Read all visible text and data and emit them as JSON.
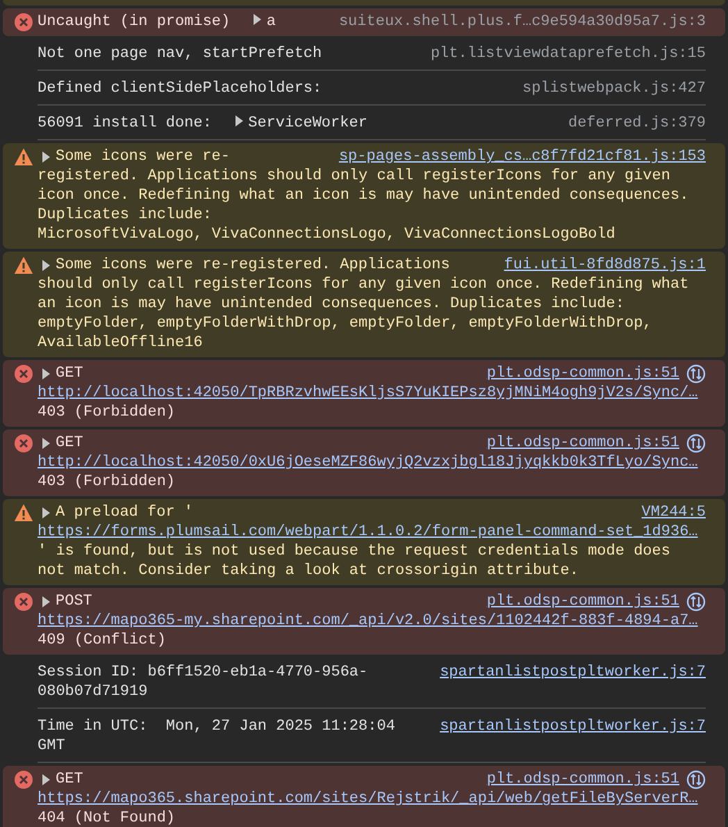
{
  "console": {
    "entries": [
      {
        "kind": "error",
        "message": "Uncaught (in promise)",
        "object": {
          "label": "a",
          "expanded": false
        },
        "source": "suiteux.shell.plus.f…c9e594a30d95a7.js:3",
        "source_link": false
      },
      {
        "kind": "info",
        "message": "Not one page nav, startPrefetch",
        "source": "plt.listviewdataprefetch.js:15",
        "source_link": false
      },
      {
        "kind": "info",
        "message": "Defined clientSidePlaceholders:",
        "source": "splistwebpack.js:427",
        "source_link": false
      },
      {
        "kind": "info",
        "message": "56091 install done:",
        "object": {
          "label": "ServiceWorker",
          "expanded": false
        },
        "source": "deferred.js:379",
        "source_link": false
      },
      {
        "kind": "warning",
        "expanded": false,
        "message": "Some icons were re-",
        "continuation": "registered. Applications should only call registerIcons for any given icon once. Redefining what an icon is may have unintended consequences. Duplicates include:\nMicrosoftVivaLogo, VivaConnectionsLogo, VivaConnectionsLogoBold",
        "source": "sp-pages-assembly_cs…c8f7fd21cf81.js:153",
        "source_link": true
      },
      {
        "kind": "warning",
        "expanded": false,
        "message": "Some icons were re-registered. Applications",
        "continuation": "should only call registerIcons for any given icon once. Redefining what an icon is may have unintended consequences. Duplicates include:\nemptyFolder, emptyFolderWithDrop, emptyFolder, emptyFolderWithDrop, AvailableOffline16",
        "source": "fui.util-8fd8d875.js:1",
        "source_link": true
      },
      {
        "kind": "error",
        "expanded": false,
        "message": "GET",
        "url": "http://localhost:42050/TpRBRzvhwEEsKljsS7YuKIEPsz8yjMNiM4ogh9jV2s/Sync/…",
        "status": "403 (Forbidden)",
        "source": "plt.odsp-common.js:51",
        "source_link": true,
        "network": true
      },
      {
        "kind": "error",
        "expanded": false,
        "message": "GET",
        "url": "http://localhost:42050/0xU6jOeseMZF86wyjQ2vzxjbgl18Jjyqkkb0k3TfLyo/Sync…",
        "status": "403 (Forbidden)",
        "source": "plt.odsp-common.js:51",
        "source_link": true,
        "network": true
      },
      {
        "kind": "warning",
        "expanded": false,
        "message": "A preload for '",
        "url": "https://forms.plumsail.com/webpart/1.1.0.2/form-panel-command-set_1d936…",
        "status": "' is found, but is not used because the request credentials mode does not match. Consider taking a look at crossorigin attribute.",
        "source": "VM244:5",
        "source_link": true
      },
      {
        "kind": "error",
        "expanded": false,
        "message": "POST",
        "url": "https://mapo365-my.sharepoint.com/_api/v2.0/sites/1102442f-883f-4894-a7…",
        "status": "409 (Conflict)",
        "source": "plt.odsp-common.js:51",
        "source_link": true,
        "network": true
      },
      {
        "kind": "info",
        "message": "Session ID: b6ff1520-eb1a-4770-956a-080b07d71919",
        "source": "spartanlistpostpltworker.js:7",
        "source_link": true
      },
      {
        "kind": "info",
        "message": "Time in UTC:  Mon, 27 Jan 2025 11:28:04 GMT",
        "source": "spartanlistpostpltworker.js:7",
        "source_link": true
      },
      {
        "kind": "error",
        "expanded": false,
        "message": "GET",
        "url": "https://mapo365.sharepoint.com/sites/Rejstrik/_api/web/getFileByServerR…",
        "status": "404 (Not Found)",
        "source": "plt.odsp-common.js:51",
        "source_link": true,
        "network": true
      }
    ]
  }
}
